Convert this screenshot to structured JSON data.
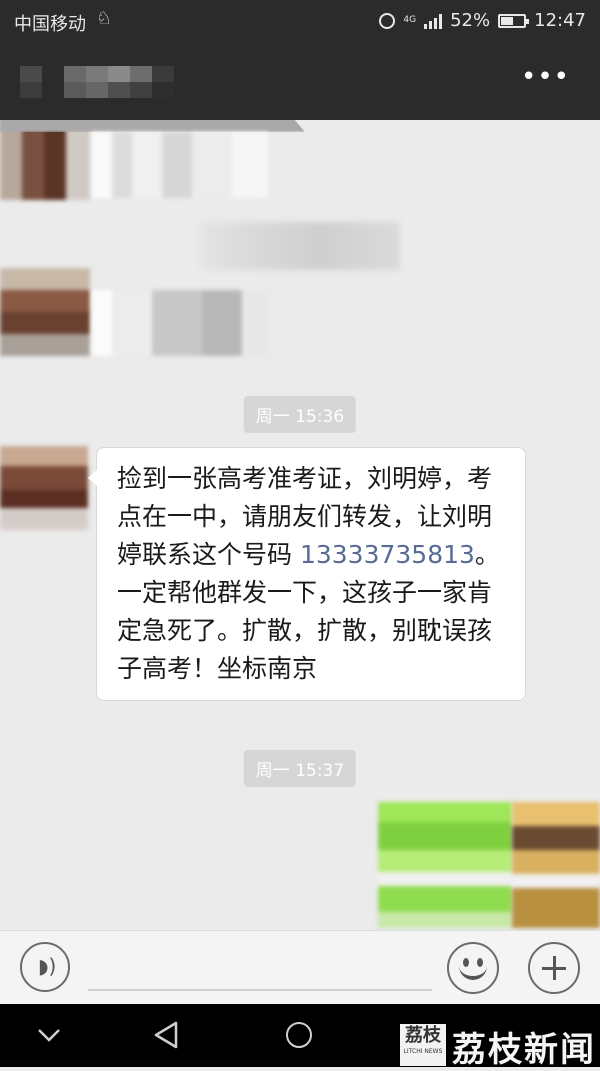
{
  "status_bar": {
    "carrier": "中国移动",
    "network": "4G",
    "battery": "52%",
    "battery_level": 0.52,
    "time": "12:47"
  },
  "title_bar": {
    "more_icon": "more-icon"
  },
  "chat": {
    "timestamp_1": "周一 15:36",
    "message": {
      "text_before": "捡到一张高考准考证，刘明婷，考点在一中，请朋友们转发，让刘明婷联系这个号码 ",
      "phone": "13333735813",
      "text_after": "。一定帮他群发一下，这孩子一家肯定急死了。扩散，扩散，别耽误孩子高考！坐标南京"
    },
    "timestamp_2": "周一 15:37"
  },
  "input_bar": {
    "voice_icon": "voice-icon",
    "emoji_icon": "emoji-icon",
    "plus_icon": "plus-icon"
  },
  "nav_bar": {
    "back_icon": "chevron-down-icon",
    "home_icon": "circle-home-icon",
    "recent_icon": "triangle-back-icon"
  },
  "watermark": {
    "logo_text": "荔枝",
    "logo_subtext": "LITCHI NEWS",
    "text": "荔枝新闻"
  },
  "colors": {
    "bar_bg": "#2b2b2b",
    "chat_bg": "#ebebeb",
    "link": "#576b95",
    "sent_bubble": "#9fe658"
  }
}
